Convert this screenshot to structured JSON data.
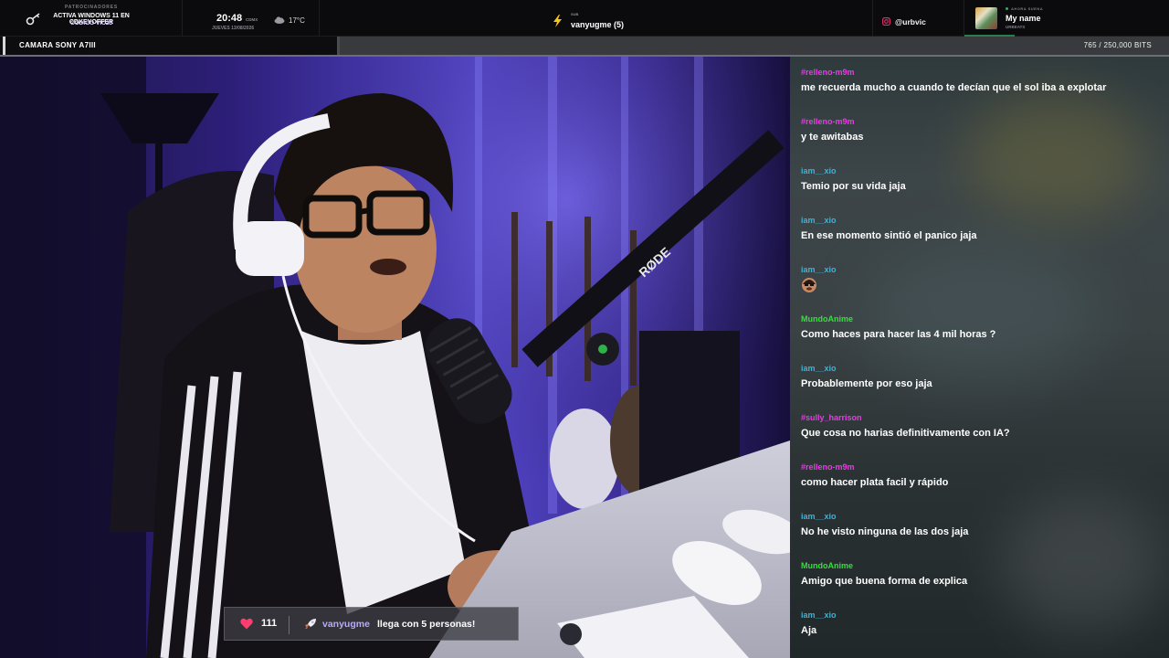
{
  "topbar": {
    "sponsor_label": "PATROCINADORES",
    "sponsor_text": "ACTIVA WINDOWS 11 EN CDKEYOFFER",
    "sponsor_code": "CÓDIGO VIC25",
    "time": "20:48",
    "timezone": "CDMX",
    "date": "JUEVES 13/08/2026",
    "temperature": "17°C",
    "sub_label": "SUB",
    "sub_name": "vanyugme (5)",
    "instagram": "@urbvic",
    "now_playing_label": "AHORA SUENA",
    "now_playing_title": "My name",
    "now_playing_artist": "URBEATS"
  },
  "subbar": {
    "camera": "CAMARA SONY A7III",
    "bits_text": "765 / 250,000 BITS",
    "bits_current": 765,
    "bits_goal": 250000
  },
  "alert": {
    "hearts": "111",
    "raid_user": "vanyugme",
    "raid_message": "llega con 5 personas!"
  },
  "colors": {
    "user_pink": "#e83be6",
    "user_cyan": "#3fb2d8",
    "user_green": "#34e03a",
    "accent_purple": "#b7aaff"
  },
  "chat": {
    "messages": [
      {
        "user": "#relleno-m9m",
        "color": "#e83be6",
        "text": "me recuerda mucho a cuando te decían que el sol iba a explotar"
      },
      {
        "user": "#relleno-m9m",
        "color": "#e83be6",
        "text": "y te awitabas"
      },
      {
        "user": "iam__xio",
        "color": "#3fb2d8",
        "text": "Temio por su vida jaja"
      },
      {
        "user": "iam__xio",
        "color": "#3fb2d8",
        "text": "En ese momento sintió el panico jaja"
      },
      {
        "user": "iam__xio",
        "color": "#3fb2d8",
        "text": "",
        "emote": "face-emote"
      },
      {
        "user": "MundoAnime",
        "color": "#34e03a",
        "text": "Como haces para hacer las 4 mil horas ?"
      },
      {
        "user": "iam__xio",
        "color": "#3fb2d8",
        "text": "Probablemente por eso jaja"
      },
      {
        "user": "#sully_harrison",
        "color": "#e83be6",
        "text": "Que cosa no harias definitivamente con IA?"
      },
      {
        "user": "#relleno-m9m",
        "color": "#e83be6",
        "text": "como hacer plata facil y rápido"
      },
      {
        "user": "iam__xio",
        "color": "#3fb2d8",
        "text": "No he visto ninguna de las dos jaja"
      },
      {
        "user": "MundoAnime",
        "color": "#34e03a",
        "text": "Amigo que buena forma de explica"
      },
      {
        "user": "iam__xio",
        "color": "#3fb2d8",
        "text": "Aja"
      }
    ]
  }
}
